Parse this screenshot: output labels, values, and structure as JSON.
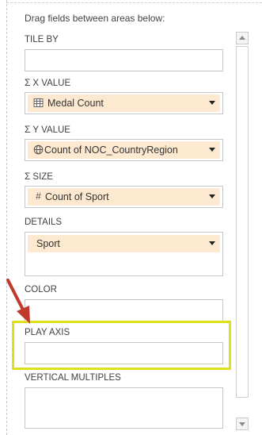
{
  "pane": {
    "intro": "Drag fields between areas below:",
    "areas": {
      "tile_by": {
        "label": "TILE BY"
      },
      "x_value": {
        "sigma": "Σ",
        "label": "X VALUE",
        "field": {
          "icon": "table-icon",
          "label": "Medal Count"
        }
      },
      "y_value": {
        "sigma": "Σ",
        "label": "Y VALUE",
        "field": {
          "icon": "globe-icon",
          "label": "Count of NOC_CountryRegion"
        }
      },
      "size": {
        "sigma": "Σ",
        "label": "SIZE",
        "field": {
          "icon": "hash-icon",
          "icon_glyph": "#",
          "label": "Count of Sport"
        }
      },
      "details": {
        "label": "DETAILS",
        "field": {
          "label": "Sport"
        }
      },
      "color": {
        "label": "COLOR"
      },
      "play_axis": {
        "label": "PLAY AXIS"
      },
      "vertical_multiples": {
        "label": "VERTICAL MULTIPLES"
      }
    }
  },
  "annotation": {
    "highlight_color": "#dfe01c",
    "arrow_color": "#c0392b"
  }
}
